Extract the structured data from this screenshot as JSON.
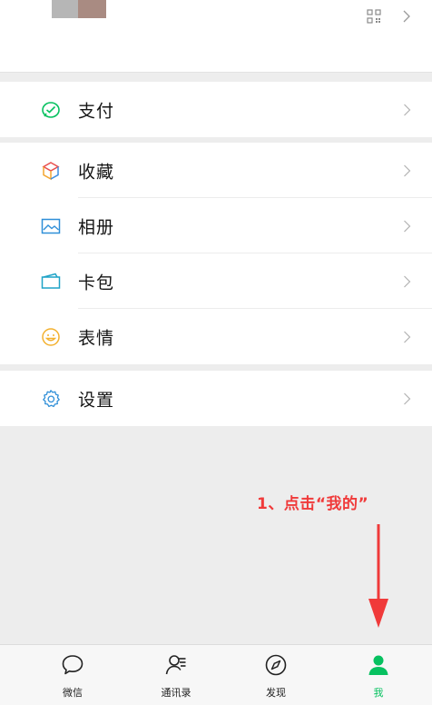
{
  "menu": {
    "pay": {
      "label": "支付"
    },
    "favorites": {
      "label": "收藏"
    },
    "album": {
      "label": "相册"
    },
    "cards": {
      "label": "卡包"
    },
    "stickers": {
      "label": "表情"
    },
    "settings": {
      "label": "设置"
    }
  },
  "annotation": {
    "text": "1、点击“我的”"
  },
  "tabbar": {
    "chats": "微信",
    "contacts": "通讯录",
    "discover": "发现",
    "me": "我"
  },
  "colors": {
    "accent_green": "#07c160",
    "annotation_red": "#f03a3a",
    "background": "#ededed"
  }
}
